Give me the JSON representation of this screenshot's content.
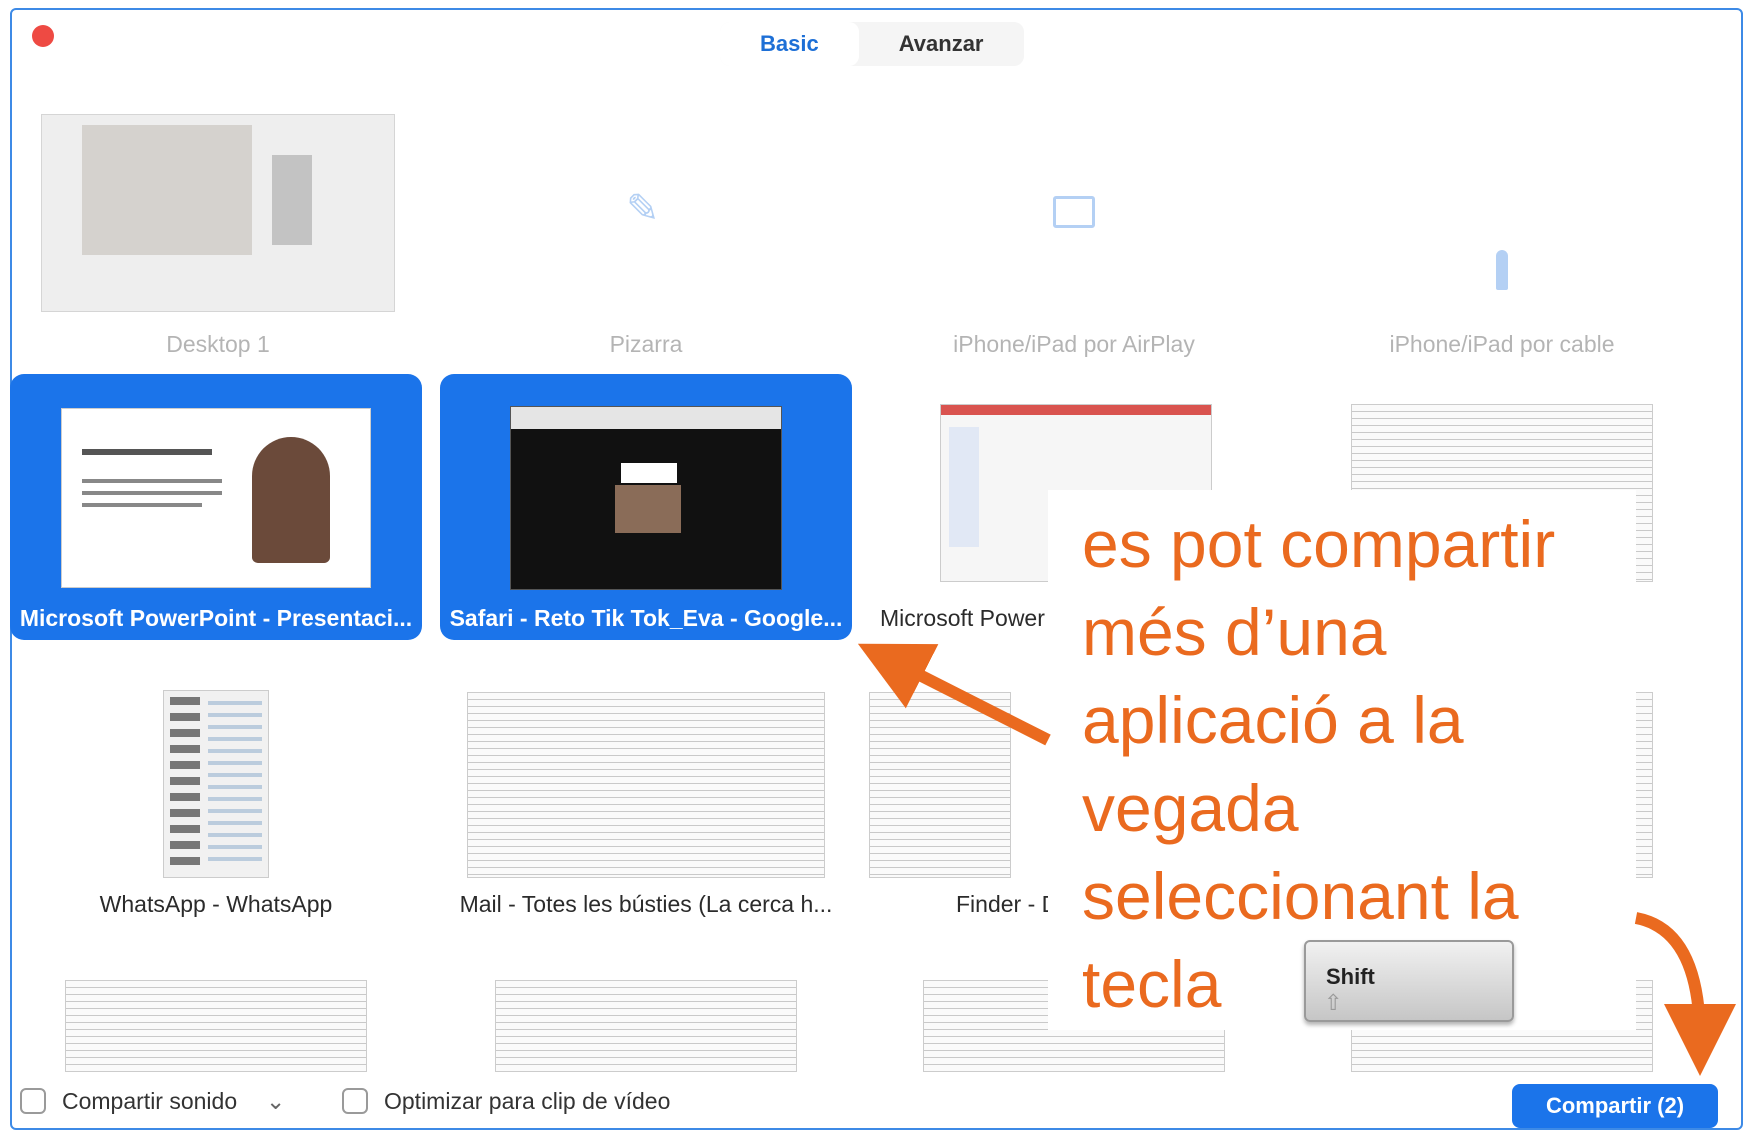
{
  "window": {
    "close_label": "close"
  },
  "tabs": [
    {
      "label": "Basic",
      "active": true
    },
    {
      "label": "Avanzar",
      "active": false
    }
  ],
  "row1": [
    {
      "label": "Desktop 1"
    },
    {
      "label": "Pizarra",
      "icon": "pencil-icon"
    },
    {
      "label": "iPhone/iPad por AirPlay",
      "icon": "airplay-icon"
    },
    {
      "label": "iPhone/iPad por cable",
      "icon": "cable-icon"
    }
  ],
  "row2": [
    {
      "label": "Microsoft PowerPoint - Presentaci...",
      "selected": true
    },
    {
      "label": "Safari - Reto Tik Tok_Eva - Google...",
      "selected": true
    },
    {
      "label": "Microsoft Power",
      "selected": false
    },
    {
      "label": "",
      "selected": false
    }
  ],
  "row3": [
    {
      "label": "WhatsApp - WhatsApp"
    },
    {
      "label": "Mail - Totes les bústies (La cerca h..."
    },
    {
      "label": "Finder - D"
    },
    {
      "label": ""
    }
  ],
  "annotation": {
    "lines": [
      "es pot compartir",
      "més d’una",
      "aplicació a la",
      "vegada",
      "seleccionant la",
      "tecla"
    ],
    "key_label": "Shift",
    "color": "#ea6a1f"
  },
  "bottom": {
    "share_sound": "Compartir sonido",
    "share_sound_chevron": "⌄",
    "optimize_video": "Optimizar para clip de vídeo",
    "share_button": "Compartir (2)"
  },
  "colors": {
    "accent": "#1b74ea",
    "close": "#ee4a43"
  }
}
